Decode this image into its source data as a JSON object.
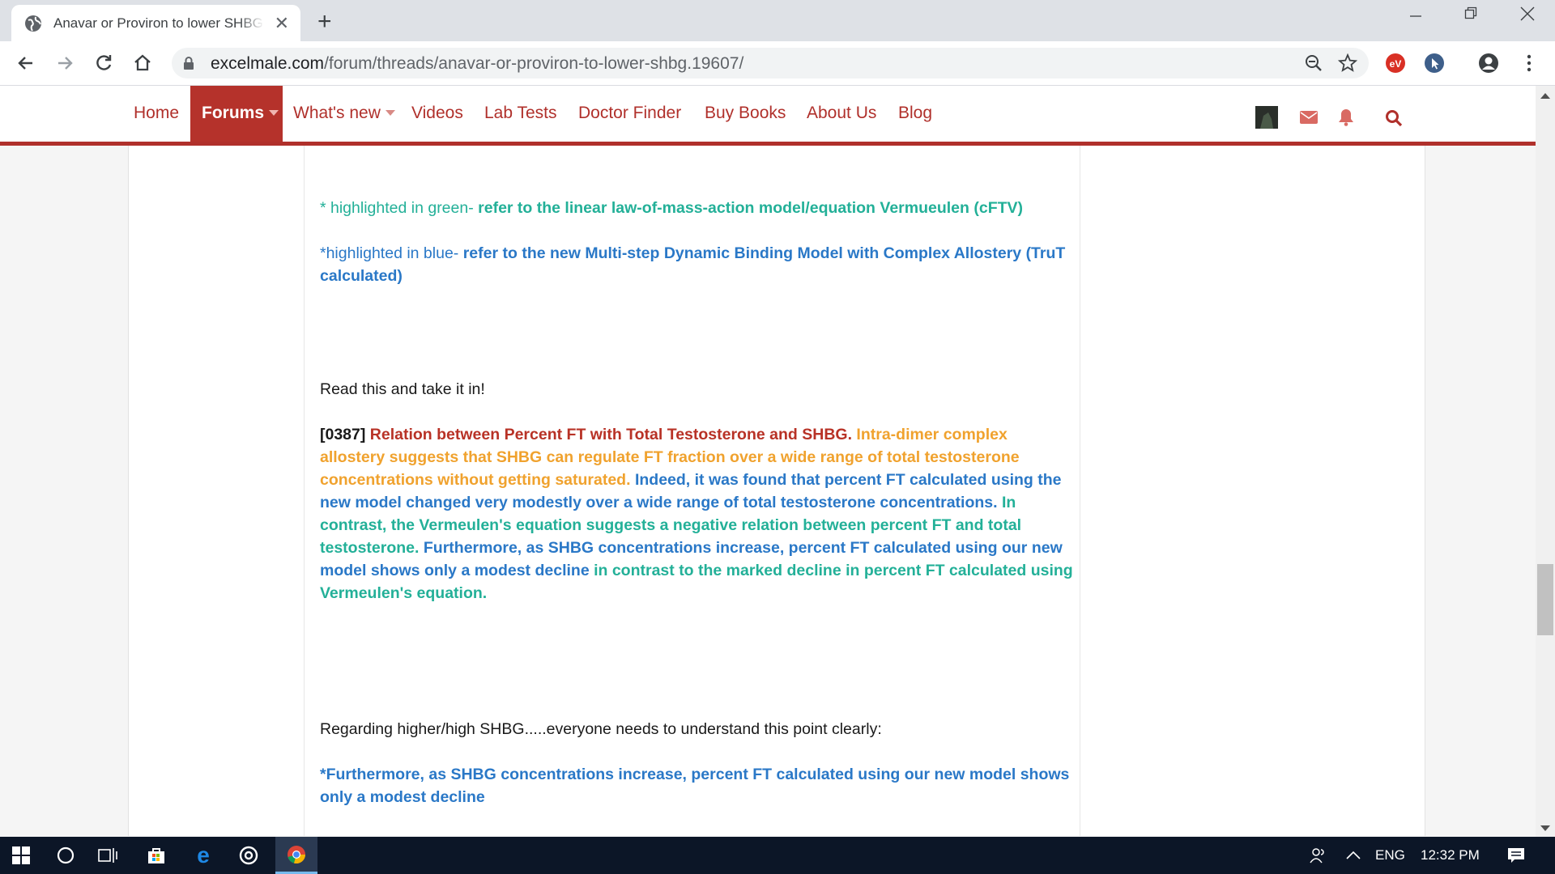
{
  "browser": {
    "tab_title": "Anavar or Proviron to lower SHBG",
    "url_domain": "excelmale.com",
    "url_path": "/forum/threads/anavar-or-proviron-to-lower-shbg.19607/",
    "extensions": [
      "ev-extension-icon",
      "pointer-extension-icon"
    ]
  },
  "nav": {
    "home": "Home",
    "forums": "Forums",
    "whats_new": "What's new",
    "videos": "Videos",
    "lab_tests": "Lab Tests",
    "doctor_finder": "Doctor Finder",
    "buy_books": "Buy Books",
    "about_us": "About Us",
    "blog": "Blog",
    "brand_color": "#b0302b"
  },
  "post": {
    "green_note_prefix": "* highlighted in green- ",
    "green_note_text": "refer to the linear law-of-mass-action model/equation Vermueulen (cFTV)",
    "blue_note_prefix": "*highlighted in blue- ",
    "blue_note_text": "refer to the new Multi-step Dynamic Binding Model with Complex Allostery (TruT calculated)",
    "read_this": "Read this and take it in!",
    "ref_id": "[0387]",
    "red_title": "Relation between Percent FT with Total Testosterone and SHBG.",
    "orange_text": "Intra-dimer complex allostery suggests that SHBG can regulate FT fraction over a wide range of total testosterone concentrations without getting saturated.",
    "blue_text_1": "Indeed, it was found that percent FT calculated using the new model changed very modestly over a wide range of total testosterone concentrations.",
    "green_text_1": "In contrast, the Vermeulen's equation suggests a negative relation between percent FT and total testosterone.",
    "blue_text_2": "Furthermore, as SHBG concentrations increase, percent FT calculated using our new model shows only a modest decline",
    "green_text_2": "in contrast to the marked decline in percent FT calculated using Vermeulen's equation.",
    "regarding": "Regarding higher/high SHBG.....everyone needs to understand this point clearly:",
    "final_quote": "*Furthermore, as SHBG concentrations increase, percent FT calculated using our new model shows only a modest decline"
  },
  "taskbar": {
    "language": "ENG",
    "time": "12:32 PM"
  }
}
